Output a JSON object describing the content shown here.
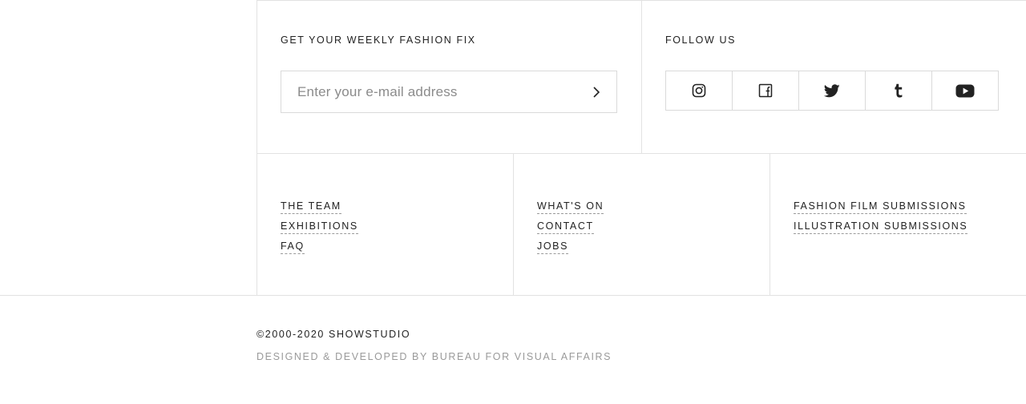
{
  "newsletter": {
    "heading": "GET YOUR WEEKLY FASHION FIX",
    "email_placeholder": "Enter your e-mail address"
  },
  "social": {
    "heading": "FOLLOW US",
    "items": [
      {
        "icon": "instagram-icon"
      },
      {
        "icon": "facebook-icon"
      },
      {
        "icon": "twitter-icon"
      },
      {
        "icon": "tumblr-icon"
      },
      {
        "icon": "youtube-icon"
      }
    ]
  },
  "links": {
    "col1": [
      "THE TEAM",
      "EXHIBITIONS",
      "FAQ"
    ],
    "col2": [
      "WHAT'S ON",
      "CONTACT",
      "JOBS"
    ],
    "col3": [
      "FASHION FILM SUBMISSIONS",
      "ILLUSTRATION SUBMISSIONS"
    ]
  },
  "footer": {
    "copyright": "©2000-2020 SHOWSTUDIO",
    "credits": "DESIGNED & DEVELOPED BY BUREAU FOR VISUAL AFFAIRS"
  },
  "colors": {
    "text": "#222222",
    "muted": "#9a9a9a",
    "border": "#e2e2e2"
  }
}
